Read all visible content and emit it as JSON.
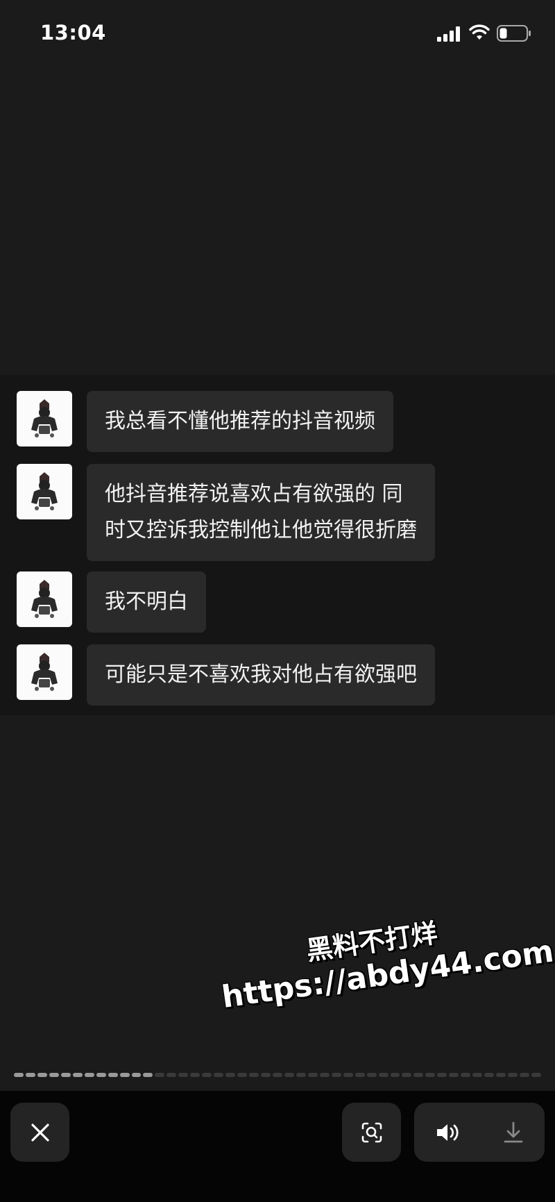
{
  "status_bar": {
    "time": "13:04",
    "icons": [
      "signal-icon",
      "wifi-icon",
      "battery-icon"
    ]
  },
  "chat": {
    "messages": [
      {
        "text": "我总看不懂他推荐的抖音视频"
      },
      {
        "text": "他抖音推荐说喜欢占有欲强的 同\n时又控诉我控制他让他觉得很折磨"
      },
      {
        "text": "我不明白"
      },
      {
        "text": "可能只是不喜欢我对他占有欲强吧"
      }
    ]
  },
  "watermark": {
    "line1": "黑料不打烊",
    "line2": "https://abdy44.com"
  },
  "progress": {
    "total_segments": 45,
    "completed_segments": 12
  },
  "toolbar": {
    "icons": [
      "close-icon",
      "scan-icon",
      "volume-icon",
      "download-icon"
    ]
  },
  "colors": {
    "background": "#1b1b1b",
    "chat_panel": "#151515",
    "bubble": "#2a2a2a",
    "toolbar": "#050505",
    "button": "#242424"
  }
}
